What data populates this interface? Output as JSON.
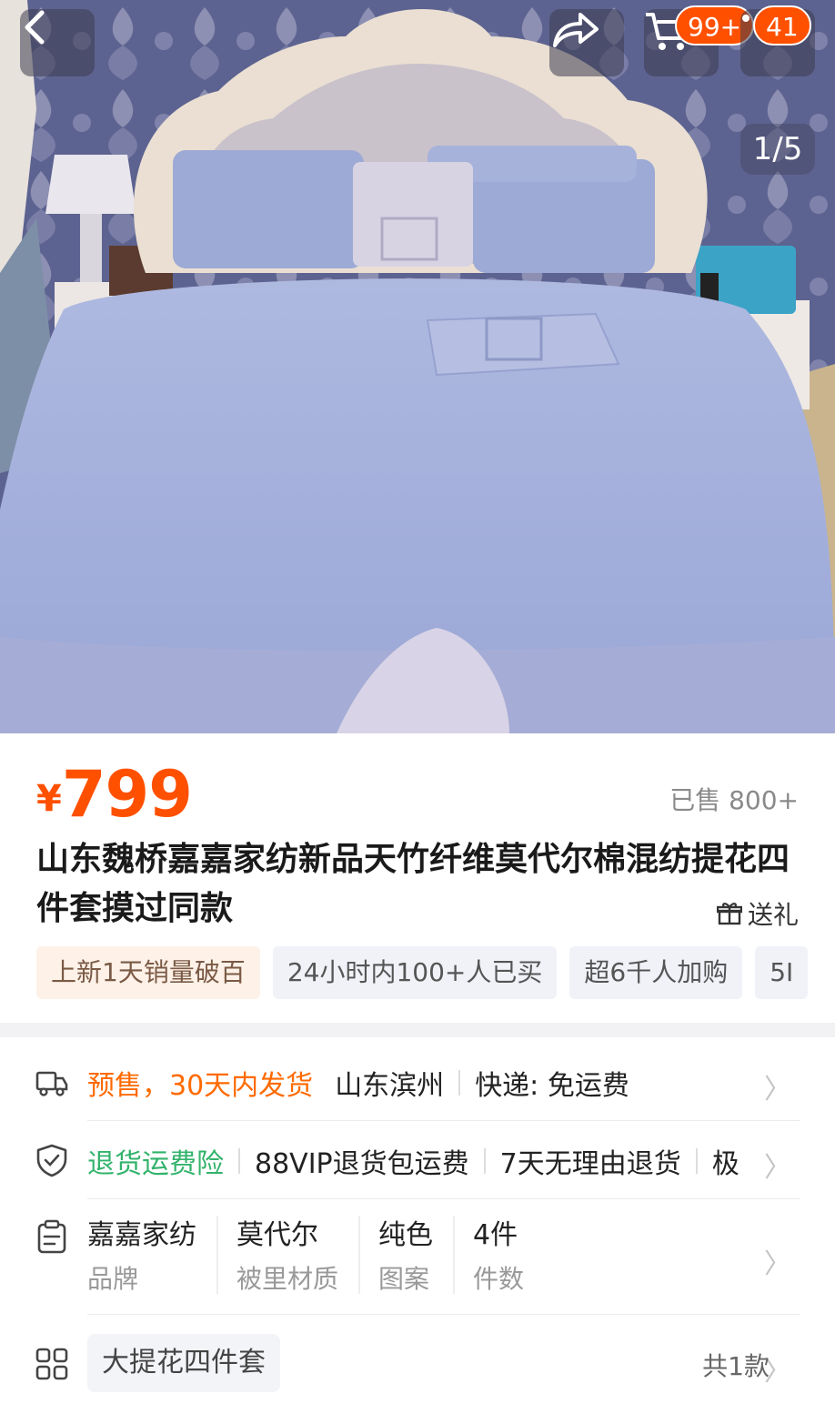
{
  "header": {
    "cart_badge": "99+",
    "msg_badge": "41",
    "gallery_index": "1/5"
  },
  "product": {
    "currency": "¥",
    "price": "799",
    "sold": "已售 800+",
    "title": "山东魏桥嘉嘉家纺新品天竹纤维莫代尔棉混纺提花四件套摸过同款",
    "gift_label": "送礼",
    "tags": [
      "上新1天销量破百",
      "24小时内100+人已买",
      "超6千人加购",
      "5I"
    ]
  },
  "shipping": {
    "presale": "预售，30天内发货",
    "origin": "山东滨州",
    "delivery": "快递: 免运费"
  },
  "service": {
    "insurance": "退货运费险",
    "vip": "88VIP退货包运费",
    "return": "7天无理由退货",
    "more": "极"
  },
  "attributes": [
    {
      "value": "嘉嘉家纺",
      "key": "品牌"
    },
    {
      "value": "莫代尔",
      "key": "被里材质"
    },
    {
      "value": "纯色",
      "key": "图案"
    },
    {
      "value": "4件",
      "key": "件数"
    }
  ],
  "sku": {
    "name": "大提花四件套",
    "count": "共1款"
  },
  "colors": {
    "accent": "#ff5000",
    "green": "#32b36b"
  }
}
